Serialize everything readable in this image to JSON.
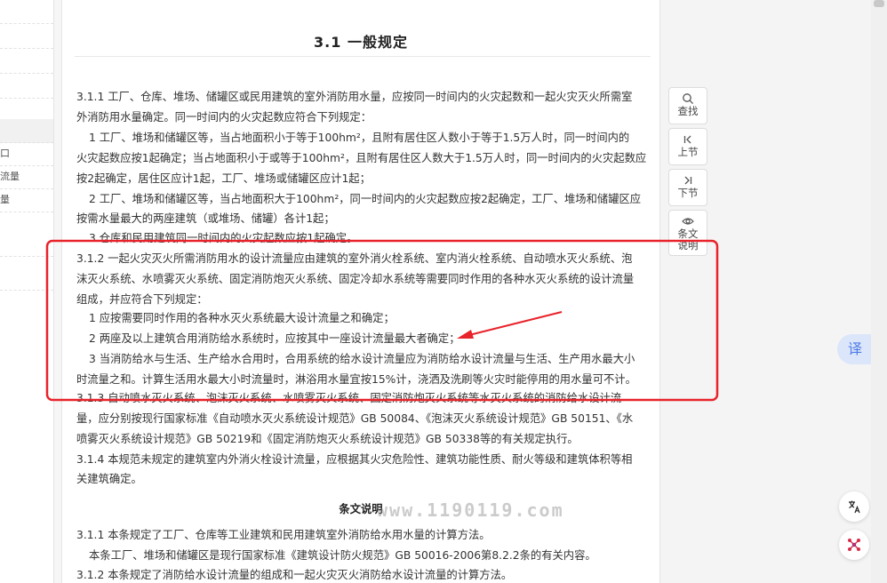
{
  "sidebar": {
    "items": [
      {
        "label": ""
      },
      {
        "label": ""
      },
      {
        "label": ""
      },
      {
        "label": ""
      },
      {
        "label": ""
      },
      {
        "label": "口"
      },
      {
        "label": "流量"
      },
      {
        "label": "量"
      },
      {
        "label": ""
      },
      {
        "label": ""
      }
    ]
  },
  "doc": {
    "title": "3.1 一般规定",
    "lines": [
      "3.1.1 工厂、仓库、堆场、储罐区或民用建筑的室外消防用水量，应按同一时间内的火灾起数和一起火灾灭火所需室",
      "外消防用水量确定。同一时间内的火灾起数应符合下列规定：",
      "1 工厂、堆场和储罐区等，当占地面积小于等于100hm²，且附有居住区人数小于等于1.5万人时，同一时间内的",
      "火灾起数应按1起确定；当占地面积小于或等于100hm²，且附有居住区人数大于1.5万人时，同一时间内的火灾起数应",
      "按2起确定，居住区应计1起，工厂、堆场或储罐区应计1起；",
      "2 工厂、堆场和储罐区等，当占地面积大于100hm²，同一时间内的火灾起数应按2起确定，工厂、堆场和储罐区应",
      "按需水量最大的两座建筑（或堆场、储罐）各计1起；",
      "3 仓库和民用建筑同一时间内的火灾起数应按1起确定。",
      "3.1.2 一起火灾灭火所需消防用水的设计流量应由建筑的室外消火栓系统、室内消火栓系统、自动喷水灭火系统、泡",
      "沫灭火系统、水喷雾灭火系统、固定消防炮灭火系统、固定冷却水系统等需要同时作用的各种水灭火系统的设计流量",
      "组成，并应符合下列规定：",
      "1 应按需要同时作用的各种水灭火系统最大设计流量之和确定；",
      "2 两座及以上建筑合用消防给水系统时，应按其中一座设计流量最大者确定；",
      "3 当消防给水与生活、生产给水合用时，合用系统的给水设计流量应为消防给水设计流量与生活、生产用水最大小",
      "时流量之和。计算生活用水最大小时流量时，淋浴用水量宜按15%计，浇洒及洗刷等火灾时能停用的用水量可不计。",
      "3.1.3 自动喷水灭火系统、泡沫灭火系统、水喷雾灭火系统、固定消防炮灭火系统等水灭火系统的消防给水设计流",
      "量，应分别按现行国家标准《自动喷水灭火系统设计规范》GB 50084、《泡沫灭火系统设计规范》GB 50151、《水",
      "喷雾灭火系统设计规范》GB 50219和《固定消防炮灭火系统设计规范》GB 50338等的有关规定执行。",
      "3.1.4 本规范未规定的建筑室内外消火栓设计流量，应根据其火灾危险性、建筑功能性质、耐火等级和建筑体积等相",
      "关建筑确定。"
    ],
    "explanation_heading": "条文说明",
    "explanation_lines": [
      "3.1.1 本条规定了工厂、仓库等工业建筑和民用建筑室外消防给水用水量的计算方法。",
      "本条工厂、堆场和储罐区是现行国家标准《建筑设计防火规范》GB 50016-2006第8.2.2条的有关内容。",
      "3.1.2 本条规定了消防给水设计流量的组成和一起火灾灭火消防给水设计流量的计算方法。"
    ],
    "watermark": "www.1190119.com"
  },
  "tools": {
    "search": "查找",
    "prev": "上节",
    "next": "下节",
    "explain": "条文说明"
  },
  "floating": {
    "translate": "译",
    "translate_icon": "translate-icon",
    "app_icon": "app-logo-icon"
  },
  "colors": {
    "annotation": "#e8232a",
    "translate_bg": "#dbe6fb",
    "translate_text": "#4d7be6"
  }
}
